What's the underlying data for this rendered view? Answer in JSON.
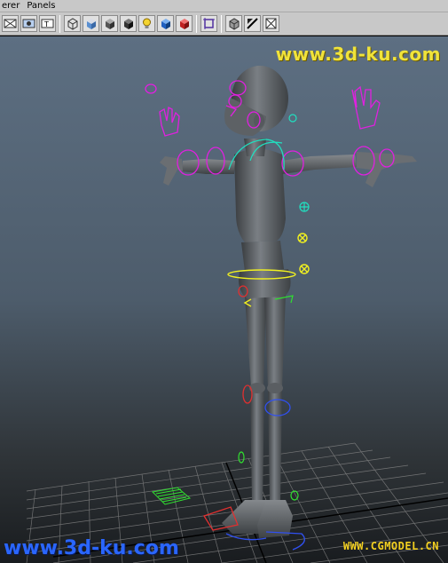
{
  "menubar": {
    "items": [
      {
        "label": "erer"
      },
      {
        "label": "Panels"
      }
    ]
  },
  "toolbar": {
    "icons": [
      "camera-select-icon",
      "camera-attributes-icon",
      "texture-icon",
      "wireframe-cube-icon",
      "smooth-shade-cube-icon",
      "flat-shade-cube-icon",
      "dark-cube-icon",
      "light-bulb-icon",
      "blue-cube-icon",
      "red-cube-icon",
      "isolate-select-icon",
      "xray-cube-icon",
      "shadow-icon",
      "resolution-gate-icon"
    ]
  },
  "watermarks": {
    "top": "www.3d-ku.com",
    "bottom": "www.3d-ku.com",
    "cgmodel": "WWW.CGMODEL.CN"
  },
  "colors": {
    "viewport_top": "#5d6f82",
    "viewport_bottom": "#191c1f",
    "control_magenta": "#e020e0",
    "control_yellow": "#f0f020",
    "control_cyan": "#20e0c0",
    "control_green": "#30e030",
    "control_red": "#e03030",
    "control_blue": "#3050f0"
  }
}
